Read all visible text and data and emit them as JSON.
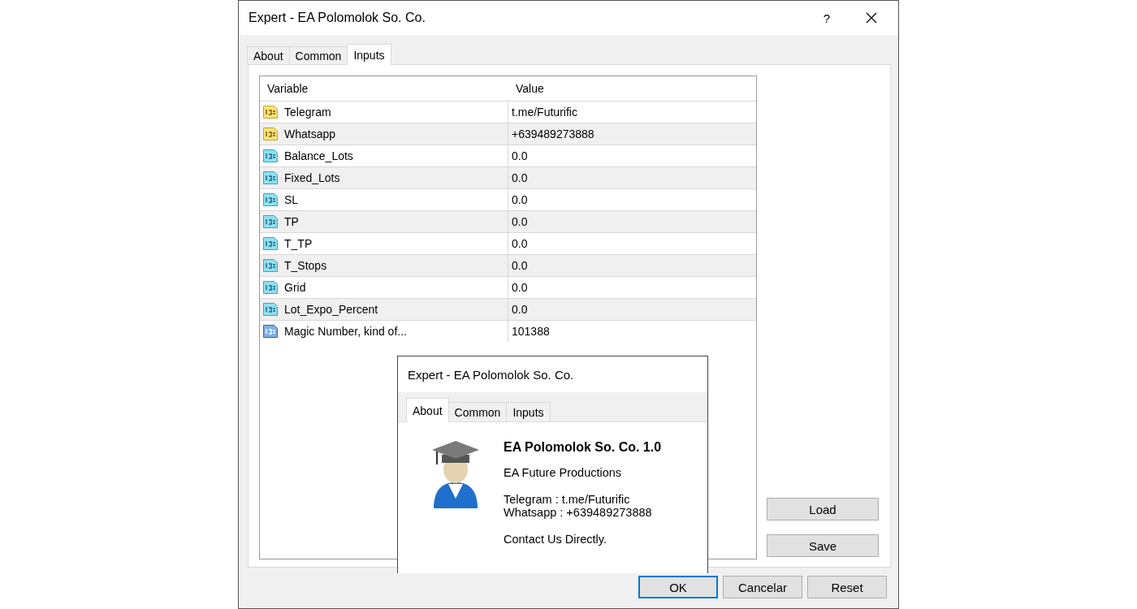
{
  "window": {
    "title": "Expert - EA Polomolok So. Co.",
    "help": "?"
  },
  "tabs": [
    {
      "label": "About",
      "selected": false
    },
    {
      "label": "Common",
      "selected": false
    },
    {
      "label": "Inputs",
      "selected": true
    }
  ],
  "table": {
    "columns": [
      "Variable",
      "Value"
    ],
    "rows": [
      {
        "kind": "string",
        "variable": "Telegram",
        "value": "t.me/Futurific"
      },
      {
        "kind": "string",
        "variable": "Whatsapp",
        "value": "+639489273888"
      },
      {
        "kind": "double",
        "variable": "Balance_Lots",
        "value": "0.0"
      },
      {
        "kind": "double",
        "variable": "Fixed_Lots",
        "value": "0.0"
      },
      {
        "kind": "double",
        "variable": "SL",
        "value": "0.0"
      },
      {
        "kind": "double",
        "variable": "TP",
        "value": "0.0"
      },
      {
        "kind": "double",
        "variable": "T_TP",
        "value": "0.0"
      },
      {
        "kind": "double",
        "variable": "T_Stops",
        "value": "0.0"
      },
      {
        "kind": "double",
        "variable": "Grid",
        "value": "0.0"
      },
      {
        "kind": "double",
        "variable": "Lot_Expo_Percent",
        "value": "0.0"
      },
      {
        "kind": "integer",
        "variable": "Magic Number, kind of...",
        "value": "101388"
      }
    ]
  },
  "side_buttons": [
    "Load",
    "Save"
  ],
  "about_window": {
    "title": "Expert - EA Polomolok So. Co.",
    "tabs": [
      {
        "label": "About",
        "selected": true
      },
      {
        "label": "Common",
        "selected": false
      },
      {
        "label": "Inputs",
        "selected": false
      }
    ],
    "heading": "EA Polomolok So. Co. 1.0",
    "company": "EA Future Productions",
    "telegram": "Telegram : t.me/Futurific",
    "whatsapp": "Whatsapp : +639489273888",
    "note": "Contact Us Directly."
  },
  "buttons": [
    {
      "label": "OK",
      "default": true
    },
    {
      "label": "Cancelar",
      "default": false
    },
    {
      "label": "Reset",
      "default": false
    }
  ]
}
